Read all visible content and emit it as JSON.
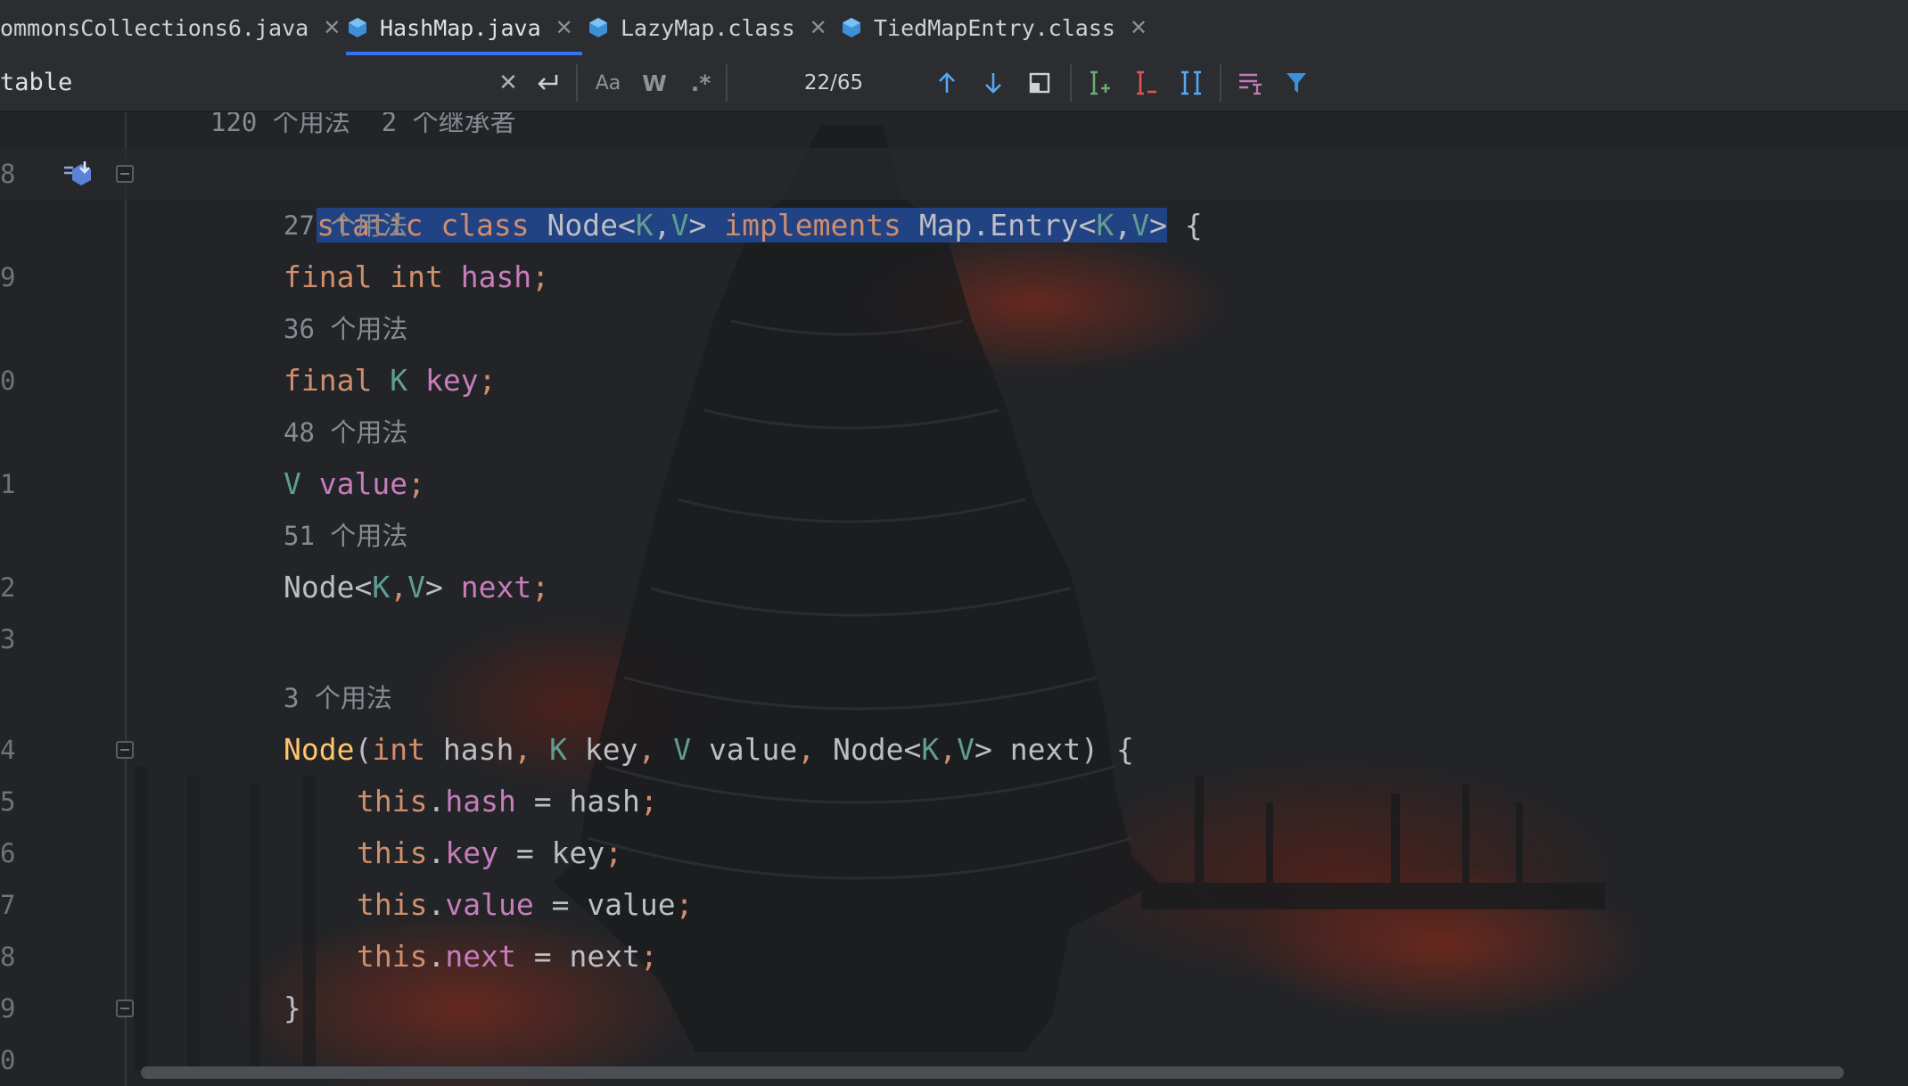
{
  "tabs": [
    {
      "label": "ommonsCollections6.java",
      "active": false
    },
    {
      "label": "HashMap.java",
      "active": true
    },
    {
      "label": "LazyMap.class",
      "active": false
    },
    {
      "label": "TiedMapEntry.class",
      "active": false
    }
  ],
  "search": {
    "query": "table",
    "match_case_label": "Aa",
    "words_label": "W",
    "regex_label": ".*",
    "match_count": "22/65"
  },
  "editor": {
    "usage_hint_top": "120 个用法  2 个继承者",
    "lines": [
      {
        "no": "8",
        "hint": "27 个用法"
      },
      {
        "no": "9",
        "hint": "36 个用法"
      },
      {
        "no": "0",
        "hint": "48 个用法"
      },
      {
        "no": "1",
        "hint": "51 个用法"
      },
      {
        "no": "2"
      },
      {
        "no": "3",
        "hint": "3 个用法"
      },
      {
        "no": "4"
      },
      {
        "no": "5"
      },
      {
        "no": "6"
      },
      {
        "no": "7"
      },
      {
        "no": "8"
      },
      {
        "no": "9"
      },
      {
        "no": "0"
      }
    ],
    "code": {
      "class_decl": [
        "static",
        "class",
        "Node<",
        "K",
        ",",
        "V",
        ">",
        "implements",
        "Map.Entry<",
        "K",
        ",",
        "V",
        ">",
        " {"
      ],
      "field_hash": [
        "final",
        "int",
        "hash",
        ";"
      ],
      "field_key": [
        "final",
        "K",
        "key",
        ";"
      ],
      "field_value": [
        "V",
        "value",
        ";"
      ],
      "field_next": [
        "Node<",
        "K",
        ",",
        "V",
        ">",
        "next",
        ";"
      ],
      "ctor": [
        "Node",
        "(",
        "int",
        "hash",
        ", ",
        "K",
        "key",
        ", ",
        "V",
        "value",
        ", ",
        "Node<",
        "K",
        ",",
        "V",
        ">",
        "next",
        ") {"
      ],
      "assign_hash": [
        "this",
        ".",
        "hash",
        " = ",
        "hash",
        ";"
      ],
      "assign_key": [
        "this",
        ".",
        "key",
        " = ",
        "key",
        ";"
      ],
      "assign_value": [
        "this",
        ".",
        "value",
        " = ",
        "value",
        ";"
      ],
      "assign_next": [
        "this",
        ".",
        "next",
        " = ",
        "next",
        ";"
      ],
      "close_brace": "}"
    }
  },
  "colors": {
    "keyword": "#cf8e6d",
    "type_param": "#5f9e91",
    "field": "#c77dbb",
    "constructor": "#ffc66d",
    "selection": "#214283",
    "accent": "#3574f0"
  }
}
